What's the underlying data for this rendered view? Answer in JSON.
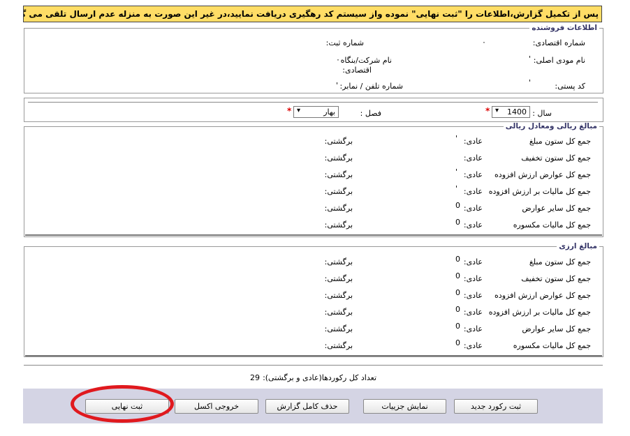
{
  "warning": "پس از تکمیل گزارش،اطلاعات را \"ثبت نهایی\" نموده واز سیستم کد رهگیری دریافت نمایید،در غیر این صورت به منزله عدم ارسال تلقی می گردد!",
  "seller": {
    "legend": "اطلاعات فروشنده",
    "economic_code_label": "شماره اقتصادی:",
    "economic_code_value": "٠",
    "reg_no_label": "شماره ثبت:",
    "name_label": "نام مودی اصلی:",
    "name_value": "'",
    "company_label_1": "نام شرکت/بنگاه",
    "company_label_2": "اقتصادی:",
    "company_value": "٠",
    "postal_label": "کد پستی:",
    "postal_value": "'",
    "phone_label": "شماره تلفن / نمابر:",
    "phone_value": "'"
  },
  "period": {
    "year_label": "سال :",
    "year_value": "1400",
    "season_label": "فصل :",
    "season_value": "بهار",
    "required_mark": "*",
    "arrow": "▾"
  },
  "rial": {
    "legend": "مبالغ ریالی ومعادل ریالی",
    "rows": [
      {
        "label": "جمع کل ستون مبلغ",
        "normal_label": "عادی:",
        "normal_value": "'",
        "return_label": "برگشتی:"
      },
      {
        "label": "جمع کل ستون تخفیف",
        "normal_label": "عادی:",
        "normal_value": "",
        "return_label": "برگشتی:"
      },
      {
        "label": "جمع کل عوارض ارزش افزوده",
        "normal_label": "عادی:",
        "normal_value": "'",
        "return_label": "برگشتی:"
      },
      {
        "label": "جمع کل مالیات بر ارزش افزوده",
        "normal_label": "عادی:",
        "normal_value": "'",
        "return_label": "برگشتی:"
      },
      {
        "label": "جمع کل سایر عوارض",
        "normal_label": "عادی:",
        "normal_value": "0",
        "return_label": "برگشتی:"
      },
      {
        "label": "جمع کل مالیات مکسوره",
        "normal_label": "عادی:",
        "normal_value": "0",
        "return_label": "برگشتی:"
      }
    ]
  },
  "foreign": {
    "legend": "مبالغ ارزی",
    "rows": [
      {
        "label": "جمع کل ستون مبلغ",
        "normal_label": "عادی:",
        "normal_value": "0",
        "return_label": "برگشتی:"
      },
      {
        "label": "جمع کل ستون تخفیف",
        "normal_label": "عادی:",
        "normal_value": "0",
        "return_label": "برگشتی:"
      },
      {
        "label": "جمع کل عوارض ارزش افزوده",
        "normal_label": "عادی:",
        "normal_value": "0",
        "return_label": "برگشتی:"
      },
      {
        "label": "جمع کل مالیات بر ارزش افزوده",
        "normal_label": "عادی:",
        "normal_value": "0",
        "return_label": "برگشتی:"
      },
      {
        "label": "جمع کل سایر عوارض",
        "normal_label": "عادی:",
        "normal_value": "0",
        "return_label": "برگشتی:"
      },
      {
        "label": "جمع کل مالیات مکسوره",
        "normal_label": "عادی:",
        "normal_value": "0",
        "return_label": "برگشتی:"
      }
    ]
  },
  "records": {
    "label": "تعداد کل رکوردها(عادی و برگشتی):",
    "value": "29"
  },
  "buttons": {
    "new_record": "ثبت رکورد جدید",
    "show_details": "نمایش جزییات",
    "delete_report": "حذف کامل گزارش",
    "excel_output": "خروجی اکسل",
    "final_submit": "ثبت نهایی"
  },
  "colors": {
    "warning_bg": "#ffdd66",
    "footer_bg": "#d4d4e4",
    "highlight_ring": "#e0191e",
    "required": "#dd0000"
  }
}
